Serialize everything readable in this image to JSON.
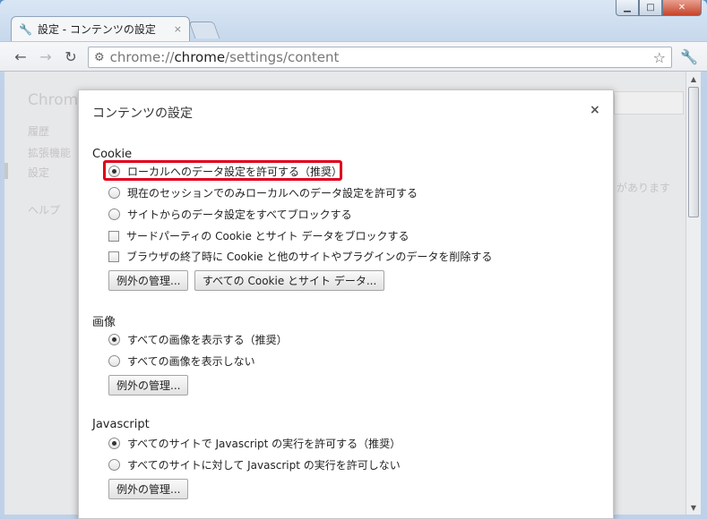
{
  "window": {
    "minimize": "▁",
    "maximize": "□",
    "close": "✕"
  },
  "tab": {
    "title": "設定 - コンテンツの設定",
    "close": "×"
  },
  "toolbar": {
    "url_prefix": "chrome://",
    "url_host": "chrome",
    "url_path": "/settings/content"
  },
  "background_page": {
    "title": "Chrom",
    "nav": [
      "履歴",
      "拡張機能",
      "設定",
      "ヘルプ"
    ],
    "right_text": "があります"
  },
  "dialog": {
    "title": "コンテンツの設定",
    "close": "×",
    "cookie": {
      "title": "Cookie",
      "radio_allow_local": "ローカルへのデータ設定を許可する（推奨）",
      "radio_session_only": "現在のセッションでのみローカルへのデータ設定を許可する",
      "radio_block_all": "サイトからのデータ設定をすべてブロックする",
      "check_block_third_party": "サードパーティの Cookie とサイト データをブロックする",
      "check_clear_on_exit": "ブラウザの終了時に Cookie と他のサイトやプラグインのデータを削除する",
      "btn_exceptions": "例外の管理...",
      "btn_all_cookies": "すべての Cookie とサイト データ..."
    },
    "images": {
      "title": "画像",
      "radio_show_all": "すべての画像を表示する（推奨）",
      "radio_show_none": "すべての画像を表示しない",
      "btn_exceptions": "例外の管理..."
    },
    "javascript": {
      "title": "Javascript",
      "radio_allow": "すべてのサイトで Javascript の実行を許可する（推奨）",
      "radio_block": "すべてのサイトに対して Javascript の実行を許可しない",
      "btn_exceptions": "例外の管理..."
    }
  },
  "colors": {
    "highlight": "#e0001a"
  }
}
